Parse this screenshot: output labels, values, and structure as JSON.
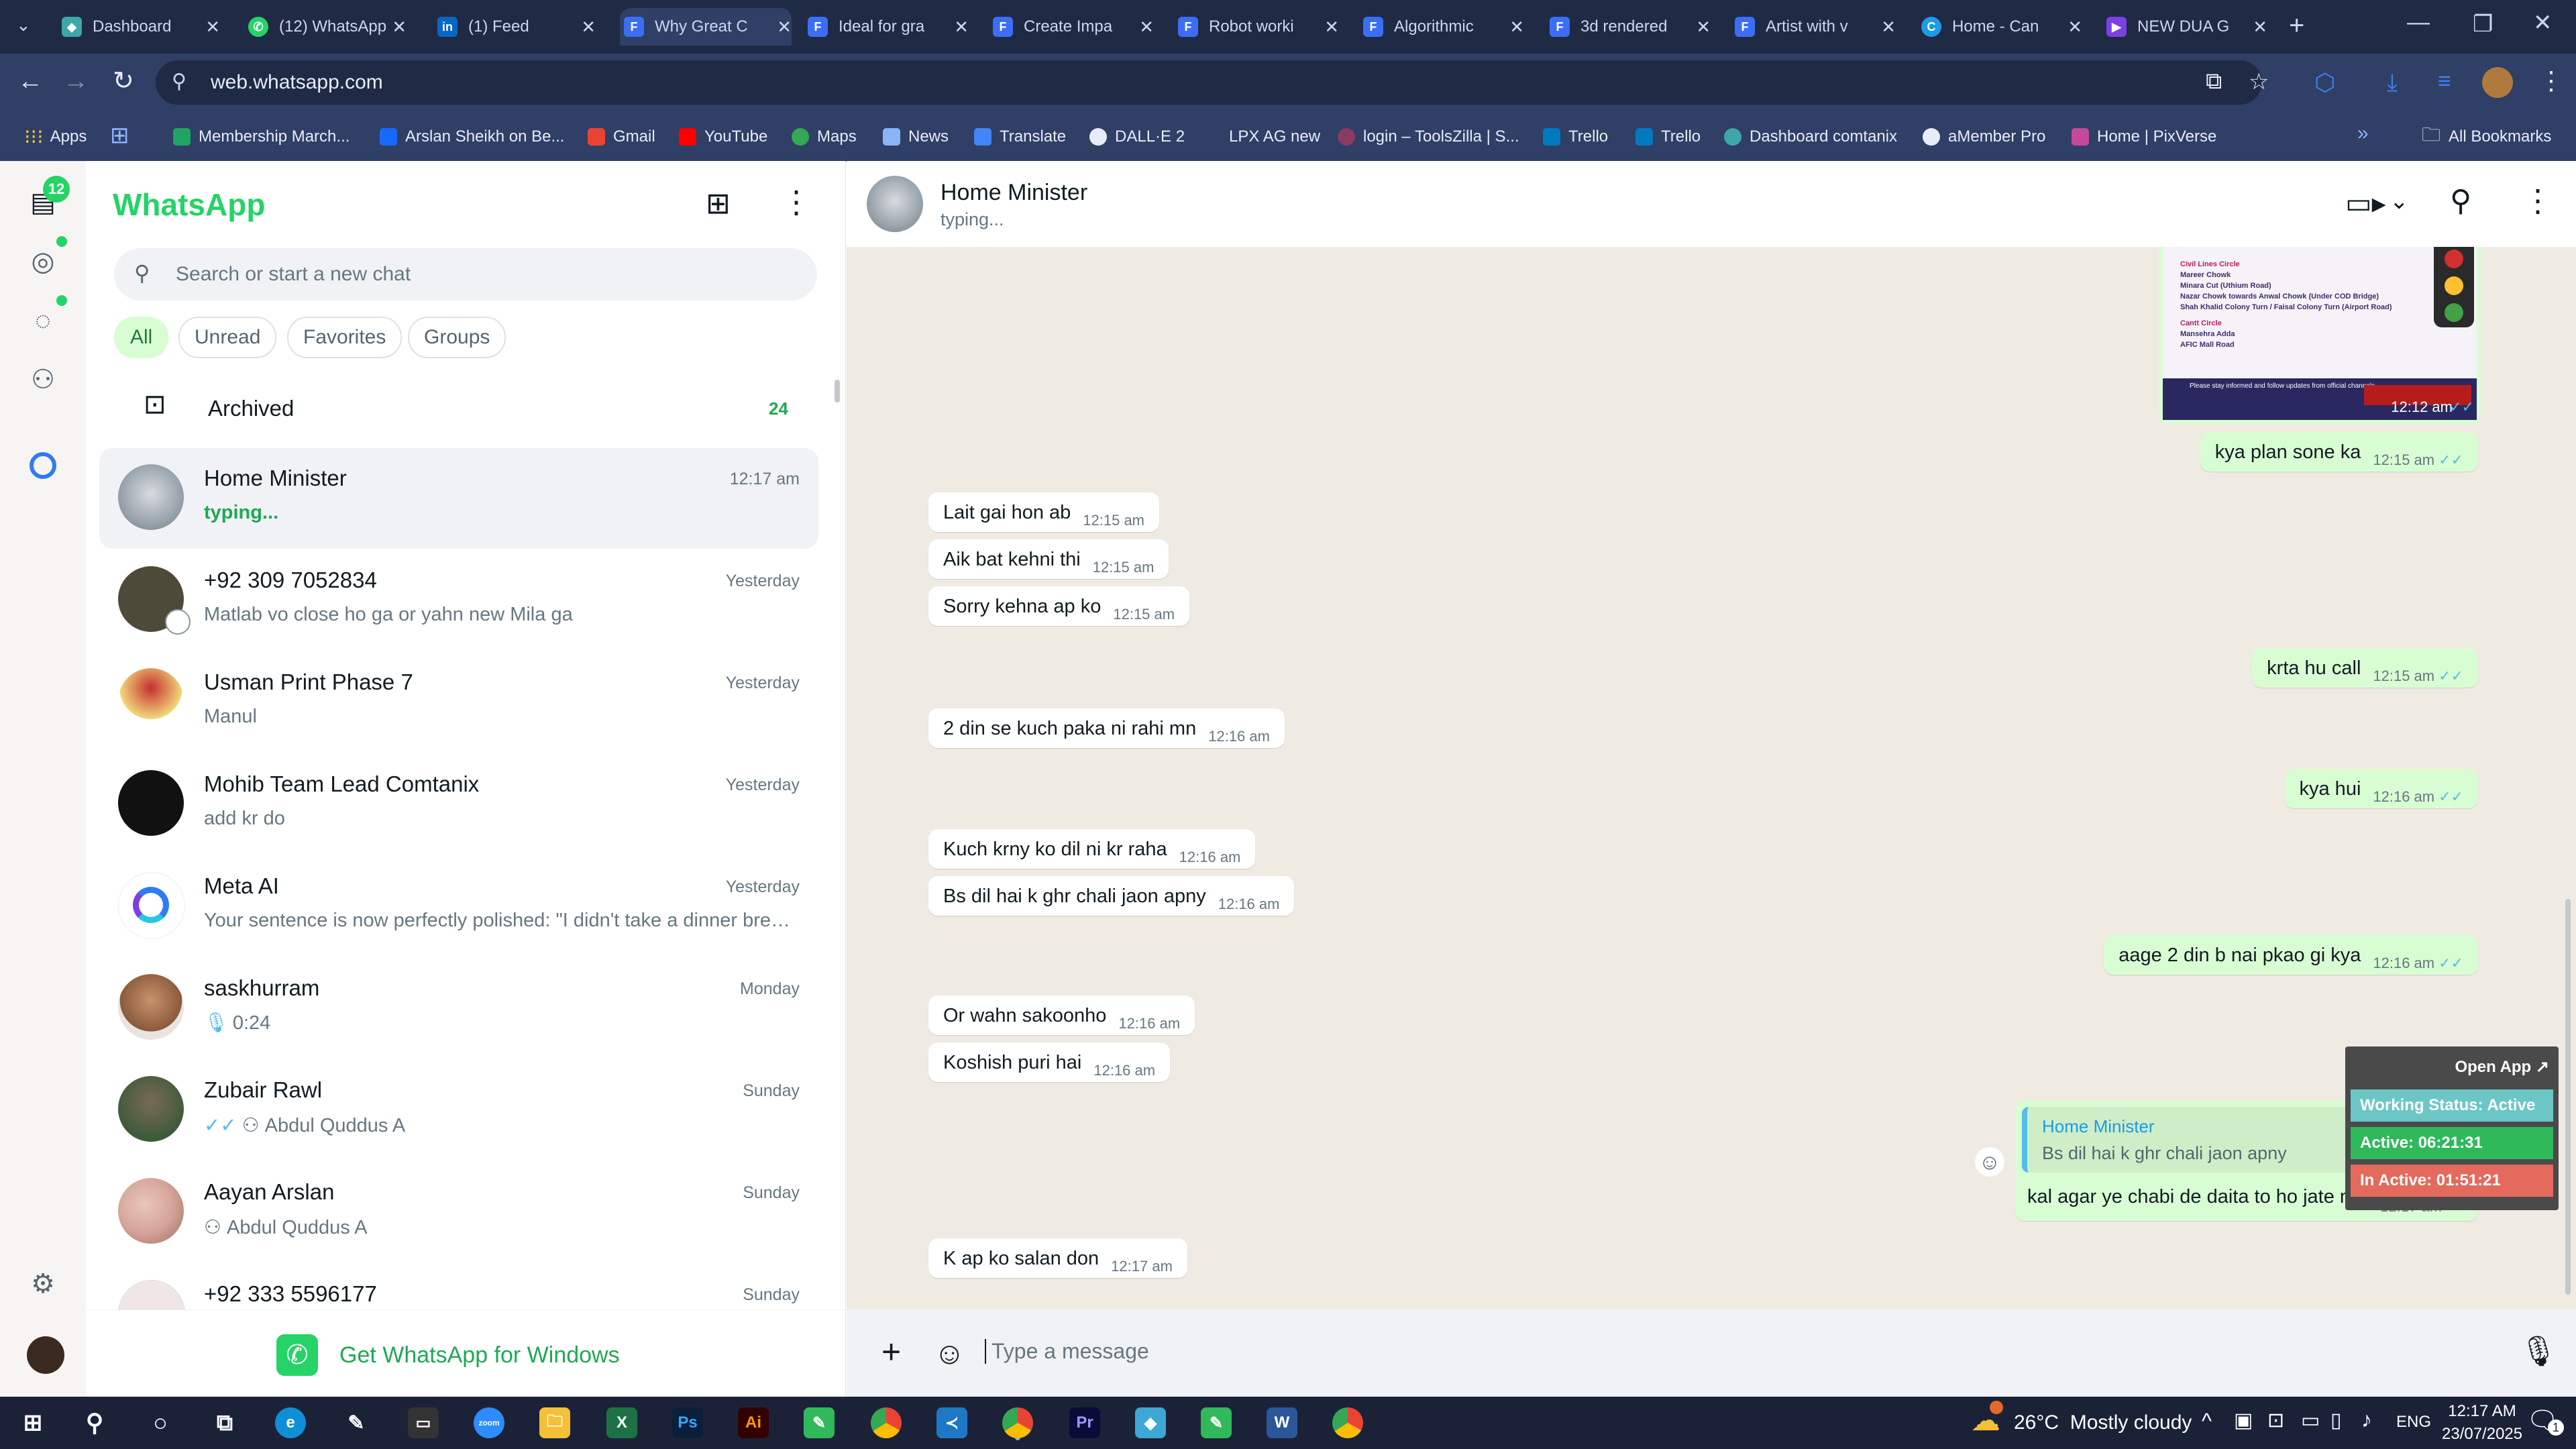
{
  "browser": {
    "tabs": [
      {
        "title": "Dashboard",
        "color": "#3ea7a7"
      },
      {
        "title": "(12) WhatsApp",
        "color": "#25d366"
      },
      {
        "title": "(1) Feed",
        "color": "#0a66c2"
      },
      {
        "title": "Why Great C",
        "color": "#3b6ef5"
      },
      {
        "title": "Ideal for gra",
        "color": "#3b6ef5"
      },
      {
        "title": "Create Impa",
        "color": "#3b6ef5"
      },
      {
        "title": "Robot worki",
        "color": "#3b6ef5"
      },
      {
        "title": "Algorithmic",
        "color": "#3b6ef5"
      },
      {
        "title": "3d rendered",
        "color": "#3b6ef5"
      },
      {
        "title": "Artist with v",
        "color": "#3b6ef5"
      },
      {
        "title": "Home - Can",
        "color": "#1c9be7"
      },
      {
        "title": "NEW DUA G",
        "color": "#7b3fe4"
      }
    ],
    "url": "web.whatsapp.com",
    "bookmarks": [
      "Apps",
      "Membership March...",
      "Arslan Sheikh on Be...",
      "Gmail",
      "YouTube",
      "Maps",
      "News",
      "Translate",
      "DALL·E 2",
      "LPX AG new",
      "login – ToolsZilla | S...",
      "Trello",
      "Trello",
      "Dashboard comtanix",
      "aMember Pro",
      "Home | PixVerse"
    ],
    "all_bookmarks": "All Bookmarks"
  },
  "rail": {
    "unread_count": "12"
  },
  "sidebar": {
    "title": "WhatsApp",
    "search_placeholder": "Search or start a new chat",
    "filters": [
      "All",
      "Unread",
      "Favorites",
      "Groups"
    ],
    "archived_label": "Archived",
    "archived_count": "24",
    "chats": [
      {
        "name": "Home Minister",
        "time": "12:17 am",
        "preview": "typing...",
        "color": "#9aa4ad"
      },
      {
        "name": "+92 309 7052834",
        "time": "Yesterday",
        "preview": "Matlab vo close ho ga or yahn new Mila ga",
        "color": "#4e4a3a"
      },
      {
        "name": "Usman Print Phase 7",
        "time": "Yesterday",
        "preview": "Manul",
        "color": "#c62f2f"
      },
      {
        "name": "Mohib Team Lead Comtanix",
        "time": "Yesterday",
        "preview": "add kr do",
        "color": "#111111"
      },
      {
        "name": "Meta AI",
        "time": "Yesterday",
        "preview": "Your sentence is now perfectly polished: \"I didn't take a dinner break,...",
        "color": "#ffffff"
      },
      {
        "name": "saskhurram",
        "time": "Monday",
        "preview": "0:24",
        "color": "#c7926c"
      },
      {
        "name": "Zubair Rawl",
        "time": "Sunday",
        "preview": "Abdul Quddus A",
        "color": "#3d5a3a"
      },
      {
        "name": "Aayan Arslan",
        "time": "Sunday",
        "preview": "Abdul Quddus A",
        "color": "#d6a59a"
      },
      {
        "name": "+92 333 5596177",
        "time": "Sunday",
        "preview": "",
        "color": "#f0e6e6"
      }
    ],
    "get_app": "Get WhatsApp for Windows"
  },
  "chat": {
    "name": "Home Minister",
    "status": "typing...",
    "image_lines": [
      "Civil Lines Circle",
      "Mareer Chowk",
      "Minara Cut (Uthium Road)",
      "Nazar Chowk towards Anwal Chowk (Under COD Bridge)",
      "Shah Khalid Colony Turn / Faisal Colony Turn (Airport Road)",
      "Cantt Circle",
      "Mansehra Adda",
      "AFIC Mall Road",
      "Please stay informed and follow updates from official channels."
    ],
    "image_time": "12:12 am",
    "messages": [
      {
        "text": "kya plan sone ka",
        "time": "12:15 am",
        "dir": "out"
      },
      {
        "text": "Lait gai hon ab",
        "time": "12:15 am",
        "dir": "in"
      },
      {
        "text": "Aik bat kehni thi",
        "time": "12:15 am",
        "dir": "in"
      },
      {
        "text": "Sorry kehna ap ko",
        "time": "12:15 am",
        "dir": "in"
      },
      {
        "text": "krta hu call",
        "time": "12:15 am",
        "dir": "out"
      },
      {
        "text": "2 din se kuch paka ni rahi mn",
        "time": "12:16 am",
        "dir": "in"
      },
      {
        "text": "kya hui",
        "time": "12:16 am",
        "dir": "out"
      },
      {
        "text": "Kuch krny ko dil ni kr raha",
        "time": "12:16 am",
        "dir": "in"
      },
      {
        "text": "Bs dil hai k ghr chali jaon apny",
        "time": "12:16 am",
        "dir": "in"
      },
      {
        "text": "aage 2 din b nai pkao gi kya",
        "time": "12:16 am",
        "dir": "out"
      },
      {
        "text": "Or wahn sakoonho",
        "time": "12:16 am",
        "dir": "in"
      },
      {
        "text": "Koshish puri hai",
        "time": "12:16 am",
        "dir": "in"
      },
      {
        "text": "kal agar ye chabi de daita to ho jate move",
        "time": "12:17 am",
        "dir": "out",
        "quote_name": "Home Minister",
        "quote_text": "Bs dil hai k ghr chali jaon apny"
      },
      {
        "text": "K ap ko salan don",
        "time": "12:17 am",
        "dir": "in"
      }
    ],
    "composer_placeholder": "Type a message"
  },
  "widget": {
    "open_app": "Open App ↗",
    "working": "Working Status: Active",
    "active": "Active: 06:21:31",
    "inactive": "In Active: 01:51:21"
  },
  "taskbar": {
    "weather": "26°C  Mostly cloudy",
    "lang": "ENG",
    "time": "12:17 AM",
    "date": "23/07/2025",
    "notif_count": "1"
  }
}
